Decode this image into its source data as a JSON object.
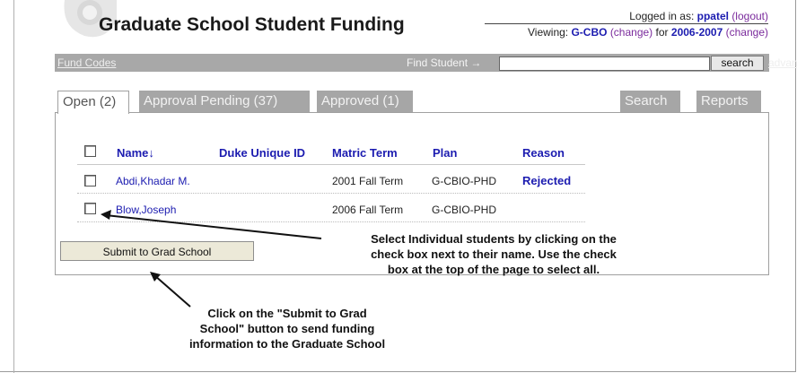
{
  "header": {
    "title": "Graduate School Student Funding",
    "logged_in_label": "Logged in as:",
    "user": "ppatel",
    "logout": "(logout)",
    "viewing_label": "Viewing:",
    "org": "G-CBO",
    "change1": "(change)",
    "for_label": "for",
    "year": "2006-2007",
    "change2": "(change)"
  },
  "toolbar": {
    "fund_codes": "Fund Codes",
    "find_student": "Find Student →",
    "find_value": "",
    "search_button": "search",
    "advanced": "advanced"
  },
  "tabs": [
    {
      "label": "Open (2)",
      "active": true
    },
    {
      "label": "Approval Pending (37)",
      "active": false
    },
    {
      "label": "Approved (1)",
      "active": false
    },
    {
      "label": "Search",
      "active": false
    },
    {
      "label": "Reports",
      "active": false
    }
  ],
  "table": {
    "columns": [
      "Name↓",
      "Duke Unique ID",
      "Matric Term",
      "Plan",
      "Reason"
    ],
    "rows": [
      {
        "name": "Abdi,Khadar M.",
        "duke_id": "",
        "matric_term": "2001 Fall Term",
        "plan": "G-CBIO-PHD",
        "reason": "Rejected"
      },
      {
        "name": "Blow,Joseph",
        "duke_id": "",
        "matric_term": "2006 Fall Term",
        "plan": "G-CBIO-PHD",
        "reason": ""
      }
    ]
  },
  "submit_button": "Submit to Grad School",
  "annotations": {
    "checkbox_note": "Select Individual students  by clicking on the\ncheck box next to their name. Use the check\nbox at the top of the page to select all.",
    "submit_note": "Click on the \"Submit to Grad\nSchool\" button to send funding\ninformation to the Graduate School"
  },
  "colors": {
    "link_blue": "#1c1cb0",
    "visited_purple": "#7a2a9c",
    "toolbar_gray": "#a8a8a8"
  }
}
